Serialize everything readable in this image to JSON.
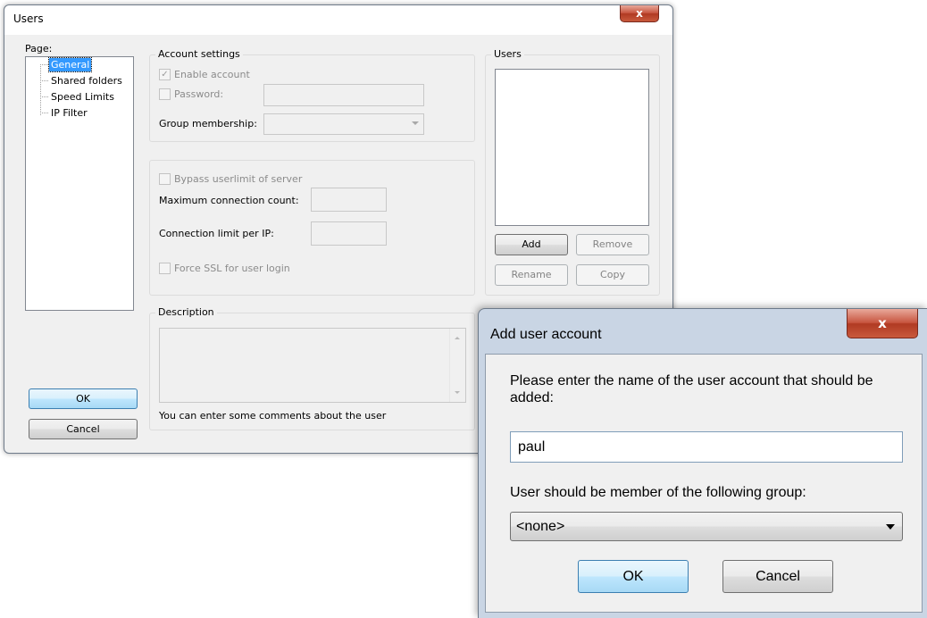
{
  "users_window": {
    "title": "Users",
    "close_label": "x",
    "page_label": "Page:",
    "pages": [
      "General",
      "Shared folders",
      "Speed Limits",
      "IP Filter"
    ],
    "account_settings": {
      "title": "Account settings",
      "enable_account": "Enable account",
      "enable_account_checked": true,
      "password_label": "Password:",
      "password_value": "",
      "group_membership_label": "Group membership:",
      "group_membership_value": ""
    },
    "limits": {
      "bypass_label": "Bypass userlimit of server",
      "max_connections_label": "Maximum connection count:",
      "max_connections_value": "",
      "conn_per_ip_label": "Connection limit per IP:",
      "conn_per_ip_value": "",
      "force_ssl_label": "Force SSL for user login"
    },
    "users_group": {
      "title": "Users",
      "add": "Add",
      "remove": "Remove",
      "rename": "Rename",
      "copy": "Copy"
    },
    "description": {
      "title": "Description",
      "hint": "You can enter some comments about the user"
    },
    "ok": "OK",
    "cancel": "Cancel"
  },
  "add_user_dialog": {
    "title": "Add user account",
    "close_label": "x",
    "prompt": "Please enter the name of the user account that should be added:",
    "name_value": "paul",
    "group_label": "User should be member of the following group:",
    "group_value": "<none>",
    "ok": "OK",
    "cancel": "Cancel"
  }
}
